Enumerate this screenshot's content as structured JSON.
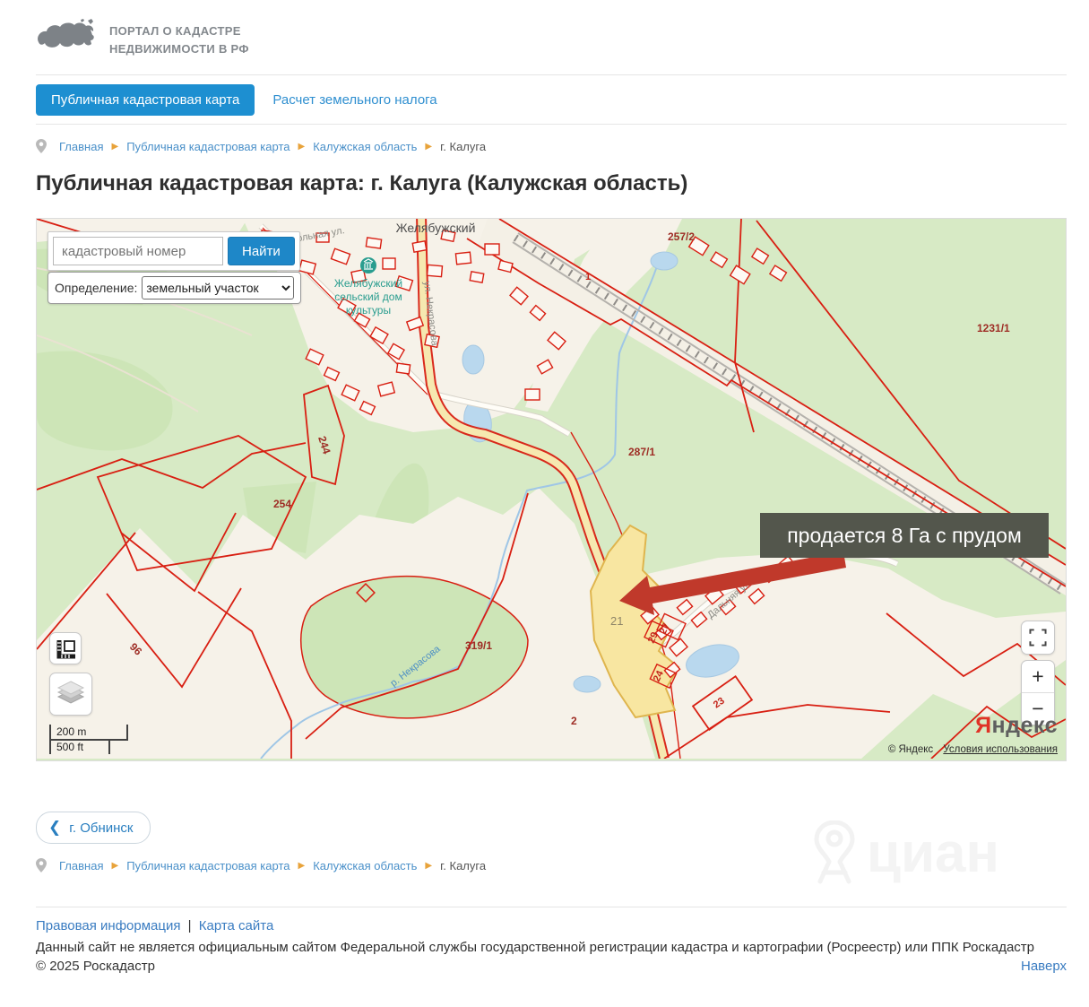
{
  "header": {
    "logo_line1": "ПОРТАЛ О КАДАСТРЕ",
    "logo_line2": "НЕДВИЖИМОСТИ В РФ"
  },
  "tabs": {
    "map": "Публичная кадастровая карта",
    "tax": "Расчет земельного налога"
  },
  "breadcrumb": {
    "home": "Главная",
    "map": "Публичная кадастровая карта",
    "region": "Калужская область",
    "city": "г. Калуга"
  },
  "page_title": "Публичная кадастровая карта: г. Калуга (Калужская область)",
  "map": {
    "search_placeholder": "кадастровый номер",
    "search_button": "Найти",
    "filter_label": "Определение:",
    "filter_value": "земельный участок",
    "tooltip": "продается 8 Га с прудом",
    "labels": {
      "village": "Желябужский",
      "street_school": "Школьная ул.",
      "street_nekrasova": "ул. Некрасова",
      "street_dalnyaya": "Дальняя ул.",
      "river": "р. Некрасова",
      "poi_line1": "Желябужский",
      "poi_line2": "сельский дом",
      "poi_line3": "культуры",
      "p257": "257/2",
      "p1231": "1231/1",
      "p287": "287/1",
      "p254": "254",
      "p244": "244",
      "p96": "96",
      "p319": "319/1",
      "p21": "21",
      "p2": "2",
      "p23": "23",
      "p24": "24",
      "p29": "29",
      "p27": "27",
      "p1": "1"
    },
    "scale_m": "200 m",
    "scale_ft": "500 ft",
    "zoom_in": "+",
    "zoom_out": "−",
    "attribution_logo": "Яндекс",
    "attribution_copyright": "© Яндекс",
    "attribution_terms": "Условия использования"
  },
  "back_button": "г. Обнинск",
  "watermark": "циан",
  "footer": {
    "legal_link": "Правовая информация",
    "divider": "|",
    "sitemap_link": "Карта сайта",
    "disclaimer": "Данный сайт не является официальным сайтом Федеральной службы государственной регистрации кадастра и картографии (Росреестр) или ППК Роскадастр",
    "copyright": "© 2025 Роскадастр",
    "to_top": "Наверх"
  },
  "colors": {
    "accent_blue": "#1d8fd1",
    "link_blue": "#3a7cc1",
    "parcel_red": "#d81f12",
    "selected_parcel_fill": "#f8e6a1",
    "map_green": "#d7eac5",
    "tooltip_bg": "#53564c",
    "arrow_red": "#c0392b",
    "separator_orange": "#e8a33b"
  }
}
